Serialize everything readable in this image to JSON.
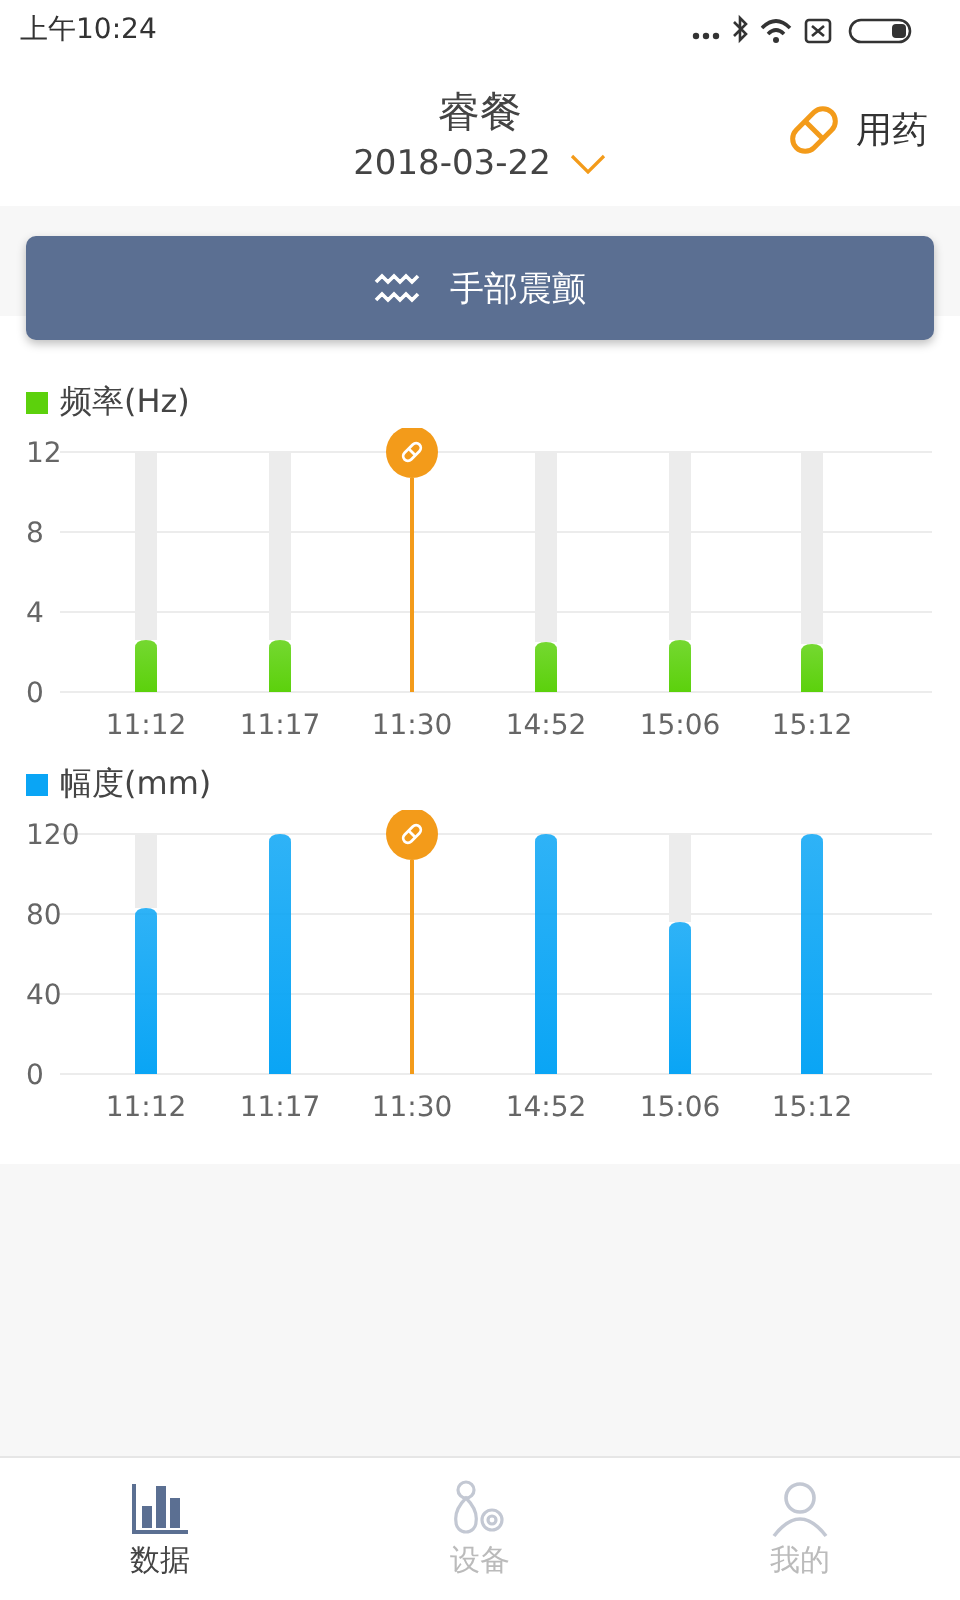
{
  "status_bar": {
    "time": "上午10:24"
  },
  "header": {
    "title": "睿餐",
    "date": "2018-03-22",
    "action": "用药"
  },
  "mode_button": {
    "label": "手部震颤"
  },
  "charts": [
    {
      "chart_data": {
        "type": "bar",
        "categories": [
          "11:12",
          "11:17",
          "11:30",
          "14:52",
          "15:06",
          "15:12"
        ],
        "ylim": [
          0,
          12
        ],
        "yticks": [
          0,
          4,
          8,
          12
        ],
        "series": [
          {
            "name": "频率(Hz)",
            "color": "#5cd10c",
            "values": [
              2.6,
              2.6,
              null,
              2.5,
              2.6,
              2.4
            ]
          }
        ],
        "annotations": [
          {
            "x": "11:30"
          }
        ]
      }
    },
    {
      "chart_data": {
        "type": "bar",
        "categories": [
          "11:12",
          "11:17",
          "11:30",
          "14:52",
          "15:06",
          "15:12"
        ],
        "ylim": [
          0,
          120
        ],
        "yticks": [
          0,
          40,
          80,
          120
        ],
        "series": [
          {
            "name": "幅度(mm)",
            "color": "#0aa5f5",
            "values": [
              83,
              120,
              null,
              120,
              76,
              120
            ]
          }
        ],
        "annotations": [
          {
            "x": "11:30"
          }
        ]
      }
    }
  ],
  "nav": [
    {
      "kind": "data",
      "label": "数据",
      "selected": true
    },
    {
      "kind": "device",
      "label": "设备",
      "selected": false
    },
    {
      "kind": "profile",
      "label": "我的",
      "selected": false
    }
  ]
}
